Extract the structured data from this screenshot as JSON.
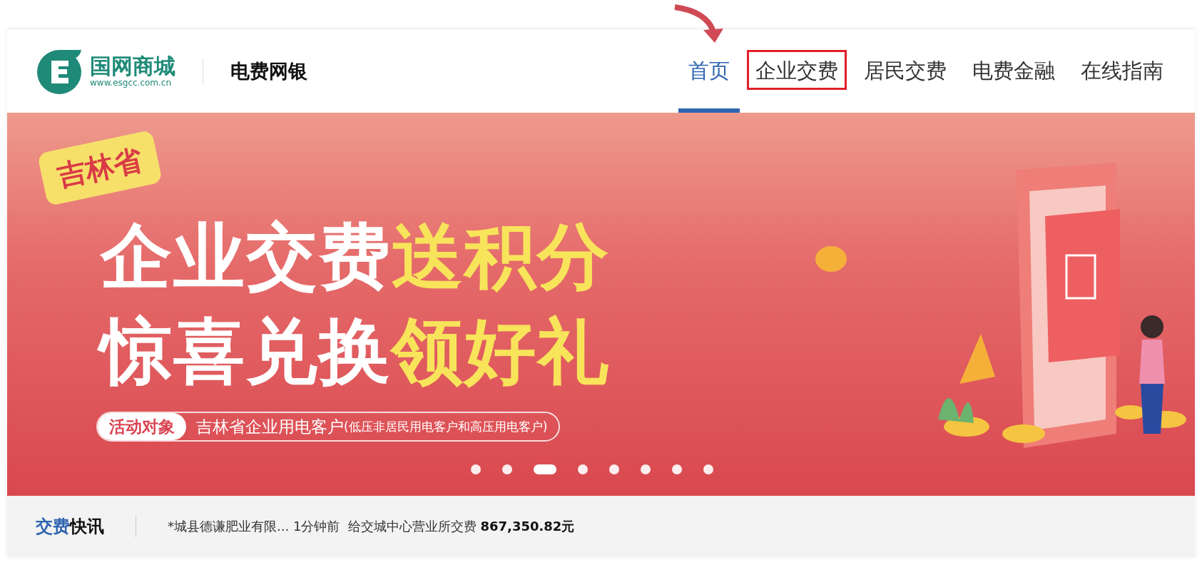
{
  "header": {
    "logo": {
      "name": "国网商城",
      "url": "www.esgcc.com.cn"
    },
    "site_title": "电费网银",
    "nav": [
      {
        "label": "首页",
        "selected": true,
        "highlighted": false
      },
      {
        "label": "企业交费",
        "selected": false,
        "highlighted": true
      },
      {
        "label": "居民交费",
        "selected": false,
        "highlighted": false
      },
      {
        "label": "电费金融",
        "selected": false,
        "highlighted": false
      },
      {
        "label": "在线指南",
        "selected": false,
        "highlighted": false
      }
    ]
  },
  "banner": {
    "badge": "吉林省",
    "headline": [
      {
        "main": "企业交费",
        "accent": "送积分"
      },
      {
        "main": "惊喜兑换",
        "accent": "领好礼"
      }
    ],
    "target": {
      "label": "活动对象",
      "text": "吉林省企业用电客户",
      "note": "(低压非居民用电客户和高压用电客户)"
    },
    "dots": [
      {
        "selected": false
      },
      {
        "selected": false
      },
      {
        "selected": true
      },
      {
        "selected": false
      },
      {
        "selected": false
      },
      {
        "selected": false
      },
      {
        "selected": false
      },
      {
        "selected": false
      }
    ]
  },
  "ticker": {
    "title_accent": "交费",
    "title": "快讯",
    "message": "*城县德谦肥业有限... 1分钟前  给交城中心营业所交费 **867,350.82元**"
  }
}
